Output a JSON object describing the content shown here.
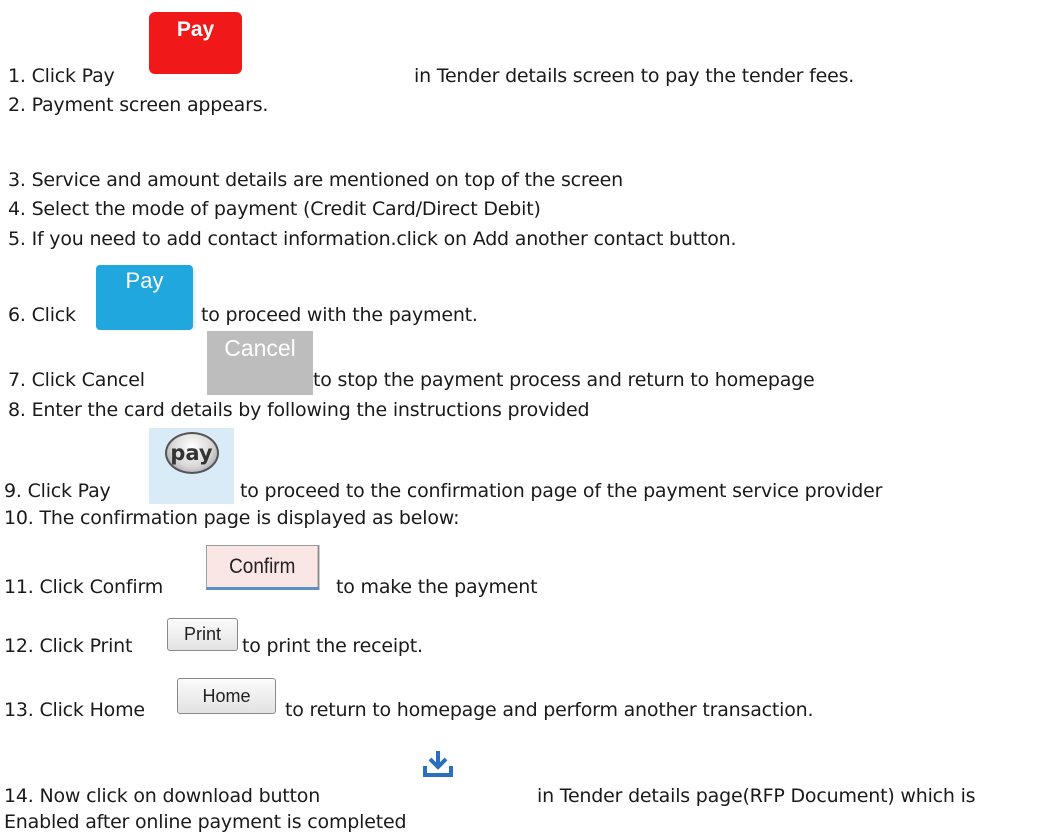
{
  "steps": [
    {
      "id": 1,
      "before": "1. Click Pay",
      "after": "in  Tender details screen to pay the tender fees."
    },
    {
      "id": 2,
      "text": "2. Payment screen appears."
    },
    {
      "id": 3,
      "text": "3. Service and amount details are mentioned on top of the screen"
    },
    {
      "id": 4,
      "text": "4. Select the mode of payment (Credit Card/Direct Debit)"
    },
    {
      "id": 5,
      "text": "5. If you need to add contact information.click on Add another contact button."
    },
    {
      "id": 6,
      "before": "6. Click",
      "after": "to proceed with the payment."
    },
    {
      "id": 7,
      "before": "7. Click Cancel",
      "after": "to stop the payment process and return to homepage"
    },
    {
      "id": 8,
      "text": "8. Enter the card details by following the instructions provided"
    },
    {
      "id": 9,
      "before": "9. Click Pay",
      "after": "to proceed to the confirmation page of the payment service provider"
    },
    {
      "id": 10,
      "text": "10. The confirmation page is displayed as below:"
    },
    {
      "id": 11,
      "before": "11. Click Confirm",
      "after": "to make the payment"
    },
    {
      "id": 12,
      "before": "12. Click Print",
      "after": "to print the receipt."
    },
    {
      "id": 13,
      "before": "13. Click Home",
      "after": "to return to homepage and perform another transaction."
    },
    {
      "id": 14,
      "before": "14. Now click on download button",
      "after": "in Tender details page(RFP Document)  which is",
      "line2": "Enabled after online payment is completed"
    }
  ],
  "buttons": {
    "pay_red": "Pay",
    "pay_blue": "Pay",
    "cancel": "Cancel",
    "pay_oval": "pay",
    "confirm": "Confirm",
    "print": "Print",
    "home": "Home"
  },
  "icons": {
    "download": "download-icon"
  },
  "colors": {
    "pay_red": "#f01818",
    "pay_blue": "#1fa7de",
    "cancel_grey": "#bdbdbd",
    "download_blue": "#2a6fc0"
  }
}
